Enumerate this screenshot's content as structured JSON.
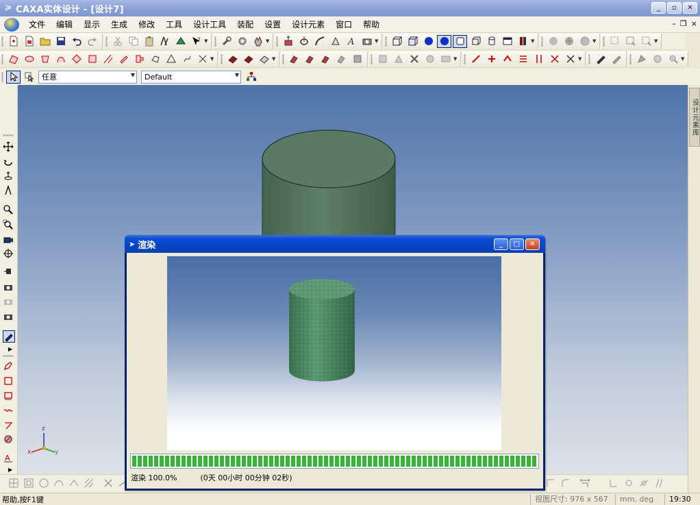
{
  "window": {
    "title": "CAXA实体设计 - [设计7]",
    "minimize": "_",
    "maximize": "▫",
    "close": "✕"
  },
  "menu": {
    "items": [
      "文件",
      "编辑",
      "显示",
      "生成",
      "修改",
      "工具",
      "设计工具",
      "装配",
      "设置",
      "设计元素",
      "窗口",
      "帮助"
    ],
    "mdi_minimize": "–",
    "mdi_restore": "❐",
    "mdi_close": "×"
  },
  "selection_bar": {
    "filter_value": "任意",
    "style_value": "Default"
  },
  "right_panel": {
    "tab_label": "设计元素库"
  },
  "axes": {
    "z": "z",
    "x": "x",
    "y": "y"
  },
  "render_dialog": {
    "title": "渲染",
    "progress_percent": 100,
    "status_text": "渲染 100.0%",
    "elapsed_text": "(0天 00小时 00分钟 02秒)"
  },
  "statusbar": {
    "help": "帮助,按F1键",
    "view_size": "视图尺寸: 976 x 567",
    "units": "mm, deg",
    "time": "19:30"
  },
  "colors": {
    "cylinder": "#5a7a66",
    "cylinder_top": "#5e7f69",
    "render_cylinder": "#4d8a63",
    "progress": "#36b332",
    "dialog_title": "#0544c4"
  }
}
